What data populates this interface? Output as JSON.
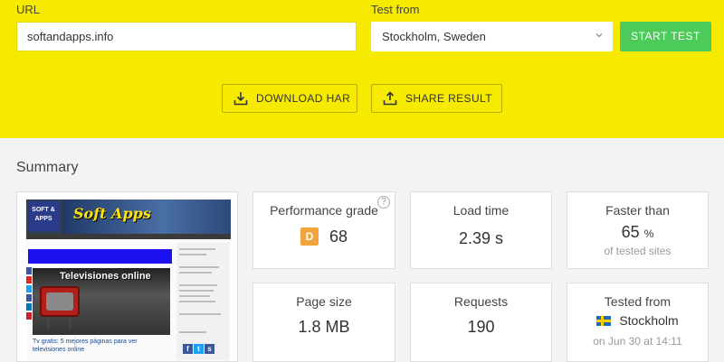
{
  "form": {
    "url_label": "URL",
    "url_value": "softandapps.info",
    "location_label": "Test from",
    "location_value": "Stockholm, Sweden",
    "start_label": "START TEST"
  },
  "actions": {
    "download_label": "DOWNLOAD HAR",
    "share_label": "SHARE RESULT"
  },
  "summary": {
    "title": "Summary",
    "performance": {
      "label": "Performance grade",
      "grade": "D",
      "score": "68",
      "help": "?"
    },
    "load_time": {
      "label": "Load time",
      "value": "2.39 s"
    },
    "faster_than": {
      "label": "Faster than",
      "value": "65",
      "unit": "%",
      "sub": "of tested sites"
    },
    "page_size": {
      "label": "Page size",
      "value": "1.8 MB"
    },
    "requests": {
      "label": "Requests",
      "value": "190"
    },
    "tested_from": {
      "label": "Tested from",
      "location": "Stockholm",
      "date": "on Jun 30 at 14:11"
    }
  },
  "preview": {
    "logo_text": "SOFT & APPS",
    "brand": "Soft  Apps",
    "hero_title": "Televisiones online",
    "caption": "Tv gratis: 5 mejores páginas para ver televisiones online"
  },
  "colors": {
    "top_band": "#f5ea00",
    "start_button": "#4ccb5a",
    "grade_badge": "#f0a43b"
  }
}
